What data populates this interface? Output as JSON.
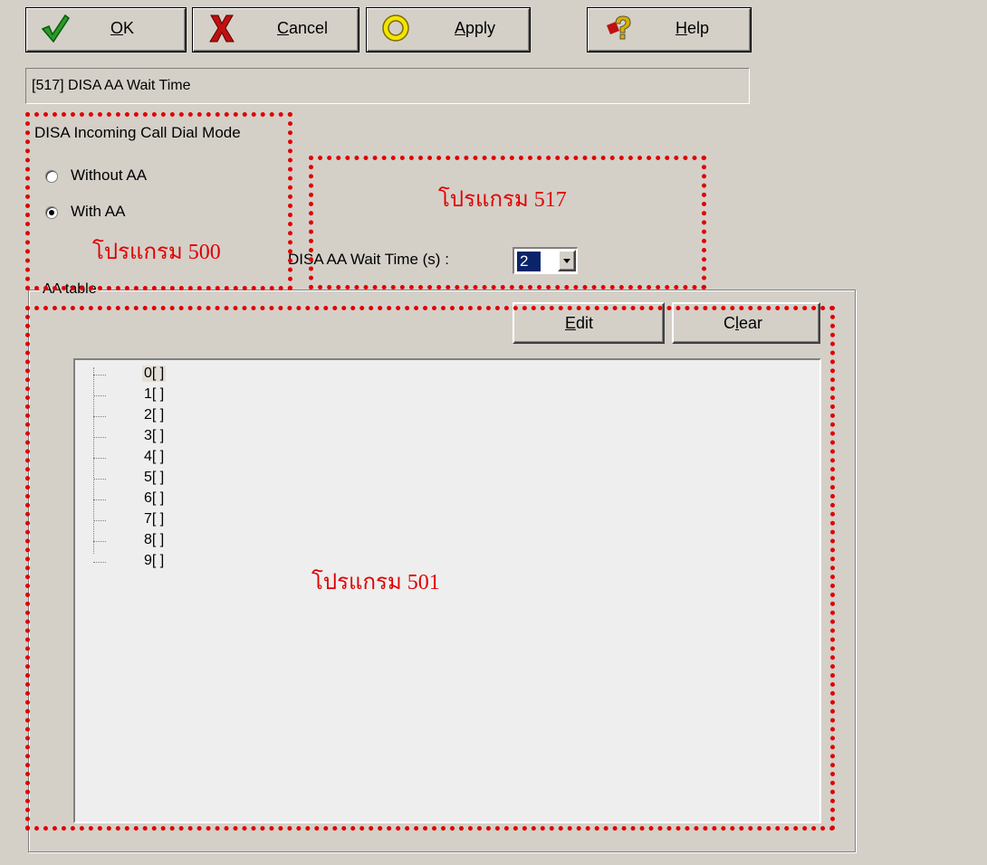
{
  "toolbar": {
    "ok": {
      "prefix": "",
      "accel": "O",
      "suffix": "K",
      "icon": "checkmark-icon"
    },
    "cancel": {
      "prefix": "",
      "accel": "C",
      "suffix": "ancel",
      "icon": "x-mark-icon"
    },
    "apply": {
      "prefix": "",
      "accel": "A",
      "suffix": "pply",
      "icon": "ring-icon"
    },
    "help": {
      "prefix": "",
      "accel": "H",
      "suffix": "elp",
      "icon": "help-icon"
    }
  },
  "program_title": "[517] DISA AA Wait Time",
  "dial_mode": {
    "label": "DISA Incoming Call Dial Mode",
    "options": [
      {
        "label": "Without AA",
        "selected": false
      },
      {
        "label": "With AA",
        "selected": true
      }
    ]
  },
  "wait_time": {
    "label": "DISA AA Wait Time (s) :",
    "value": "2",
    "dropdown_icon": "chevron-down-icon"
  },
  "aa_table": {
    "title": "AA table",
    "edit_button": {
      "prefix": "",
      "accel": "E",
      "suffix": "dit"
    },
    "clear_button": {
      "prefix": "C",
      "accel": "l",
      "suffix": "ear"
    },
    "items": [
      "0[ ]",
      "1[ ]",
      "2[ ]",
      "3[ ]",
      "4[ ]",
      "5[ ]",
      "6[ ]",
      "7[ ]",
      "8[ ]",
      "9[ ]"
    ]
  },
  "annotations": {
    "program_500": "โปรแกรม 500",
    "program_517": "โปรแกรม 517",
    "program_501": "โปรแกรม 501"
  },
  "colors": {
    "face": "#d4d0c8",
    "annotation_red": "#e00000",
    "selection": "#0a246a"
  }
}
